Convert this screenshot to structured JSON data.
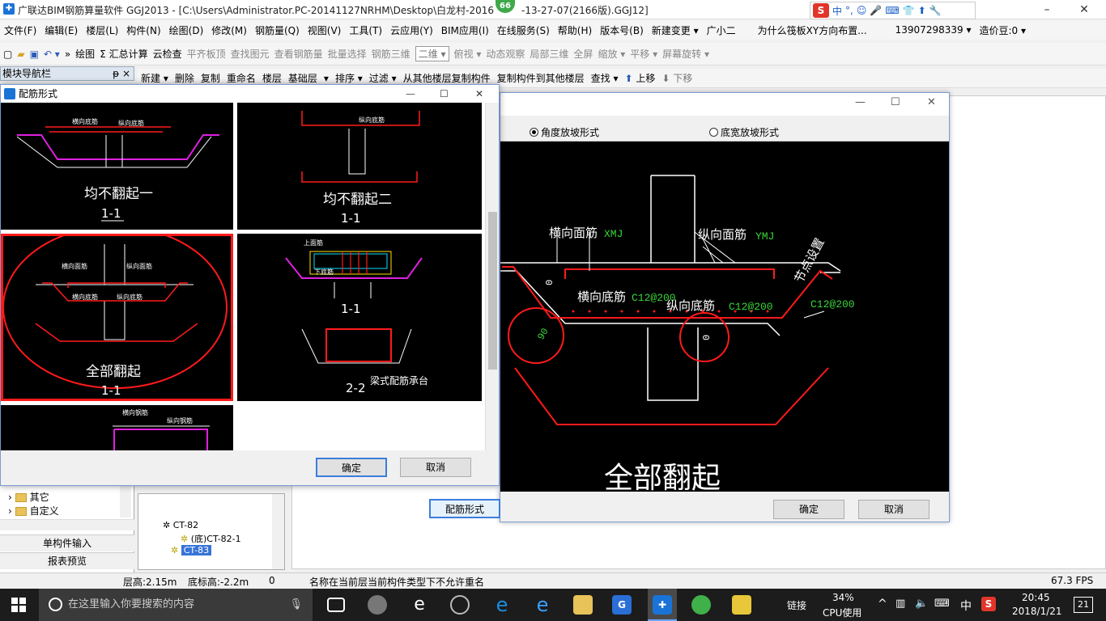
{
  "app": {
    "title": "广联达BIM钢筋算量软件 GGJ2013 - [C:\\Users\\Administrator.PC-20141127NRHM\\Desktop\\白龙村-2016",
    "title_suffix": "-13-27-07(2166版).GGJ12]",
    "badge": "66"
  },
  "ime": {
    "items": [
      "中",
      "°,",
      "☺",
      "🎤",
      "⌨",
      "👕",
      "⬆",
      "🔧"
    ]
  },
  "menu": [
    "文件(F)",
    "编辑(E)",
    "楼层(L)",
    "构件(N)",
    "绘图(D)",
    "修改(M)",
    "钢筋量(Q)",
    "视图(V)",
    "工具(T)",
    "云应用(Y)",
    "BIM应用(I)",
    "在线服务(S)",
    "帮助(H)",
    "版本号(B)",
    "新建变更 ▾",
    "广小二",
    "为什么筏板XY方向布置...",
    "13907298339 ▾",
    "造价豆:0 ▾"
  ],
  "toolbar1": [
    "绘图",
    "Σ 汇总计算",
    "云检查",
    "平齐板顶",
    "查找图元",
    "查看钢筋量",
    "批量选择",
    "钢筋三维",
    "二维",
    "俯视 ▾",
    "动态观察",
    "局部三维",
    "全屏",
    "缩放 ▾",
    "平移 ▾",
    "屏幕旋转 ▾"
  ],
  "toolbar2": [
    "新建 ▾",
    "删除",
    "复制",
    "重命名",
    "楼层",
    "基础层",
    "▾",
    "排序 ▾",
    "过滤 ▾",
    "从其他楼层复制构件",
    "复制构件到其他楼层",
    "查找 ▾",
    "上移",
    "下移"
  ],
  "nav": {
    "header": "模块导航栏",
    "pin": "ᵽ ×"
  },
  "left_tree": [
    {
      "label": "其它"
    },
    {
      "label": "自定义"
    }
  ],
  "left_buttons": [
    "单构件输入",
    "报表预览"
  ],
  "mid_tree": [
    {
      "label": "CT-82"
    },
    {
      "label": "(底)CT-82-1"
    },
    {
      "label": "CT-83"
    }
  ],
  "status": {
    "floor_height": "层高:2.15m",
    "bottom_elev": "底标高:-2.2m",
    "zero": "0",
    "message": "名称在当前层当前构件类型下不允许重名",
    "fps": "67.3 FPS"
  },
  "dialog1": {
    "title": "配筋形式",
    "cells": [
      {
        "label": "均不翻起一",
        "sub": "1-1"
      },
      {
        "label": "均不翻起二",
        "sub": "1-1"
      },
      {
        "label": "全部翻起",
        "sub": "1-1"
      },
      {
        "label": "梁式配筋承台",
        "sub": "2-2",
        "sub2": "1-1"
      }
    ],
    "tags": [
      "横向底筋",
      "纵向底筋",
      "横向面筋",
      "纵向面筋",
      "横向钢筋",
      "纵向钢筋",
      "上面筋",
      "下底筋"
    ],
    "ok": "确定",
    "cancel": "取消"
  },
  "dialog2": {
    "radio_angle": "角度放坡形式",
    "radio_bottom": "底宽放坡形式",
    "labels": {
      "h_top": "横向面筋",
      "h_top_code": "XMJ",
      "v_top": "纵向面筋",
      "v_top_code": "YMJ",
      "node": "节点设置",
      "h_bot": "横向底筋",
      "h_bot_code": "C12@200",
      "v_bot": "纵向底筋",
      "v_bot_code": "C12@200",
      "right_code": "C12@200",
      "angle": "90",
      "zero1": "0",
      "zero2": "0",
      "big": "全部翻起"
    },
    "btn_form": "配筋形式",
    "ok": "确定",
    "cancel": "取消"
  },
  "taskbar": {
    "search": "在这里输入你要搜索的内容",
    "link": "链接",
    "cpu": "34%",
    "cpu_label": "CPU使用",
    "ime": "中",
    "time": "20:45",
    "date": "2018/1/21",
    "notif": "21"
  },
  "colors": {
    "accent": "#1a73d6",
    "select": "#3874d8",
    "rebar": "#ff1a1a",
    "tag": "#39d639",
    "magenta": "#e020e0"
  }
}
